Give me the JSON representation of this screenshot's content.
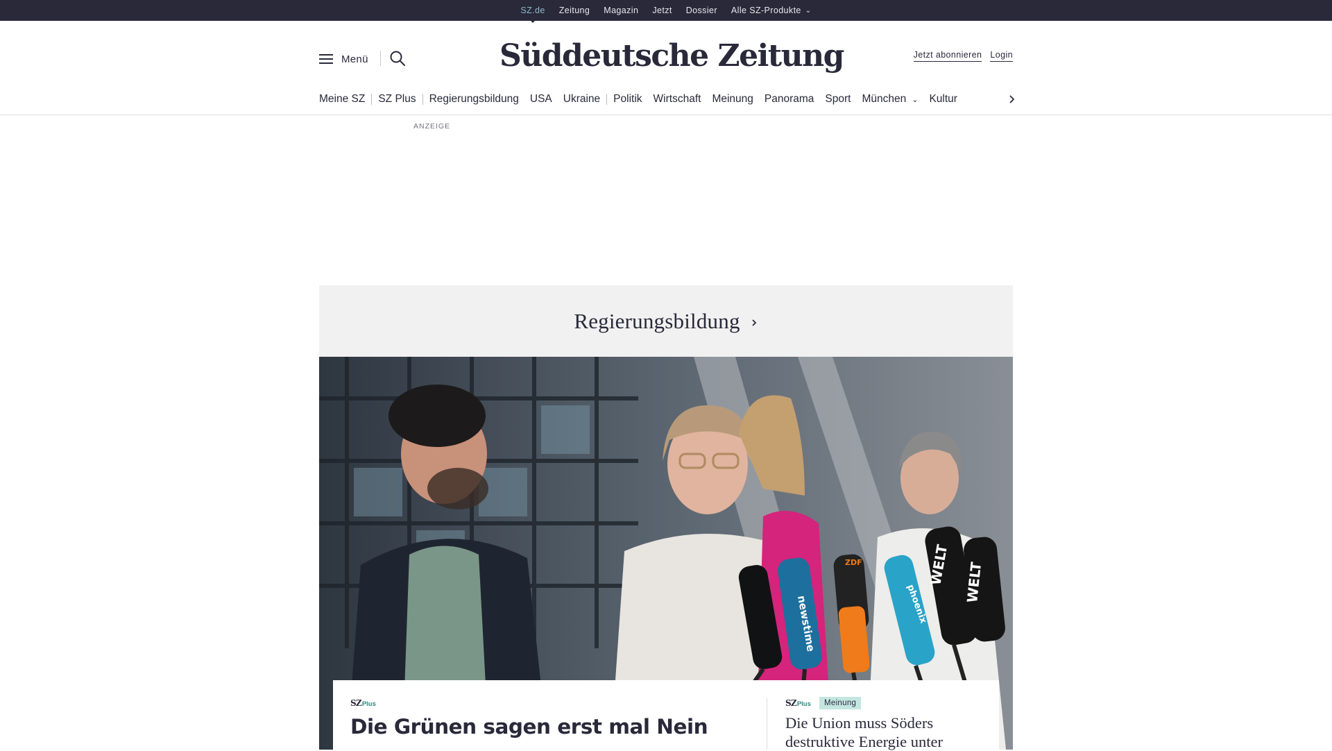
{
  "topbar": {
    "items": [
      {
        "label": "SZ.de",
        "active": true
      },
      {
        "label": "Zeitung"
      },
      {
        "label": "Magazin"
      },
      {
        "label": "Jetzt"
      },
      {
        "label": "Dossier"
      },
      {
        "label": "Alle SZ-Produkte",
        "dropdown": true
      }
    ]
  },
  "header": {
    "menu_label": "Menü",
    "logo": "Süddeutsche Zeitung",
    "subscribe_label": "Jetzt abonnieren",
    "login_label": "Login"
  },
  "nav": {
    "items": [
      "Meine SZ",
      "SZ Plus",
      "Regierungsbildung",
      "USA",
      "Ukraine",
      "Politik",
      "Wirtschaft",
      "Meinung",
      "Panorama",
      "Sport",
      "München",
      "Kultur"
    ],
    "dropdown_item": "München"
  },
  "ad": {
    "label": "ANZEIGE"
  },
  "topic": {
    "title": "Regierungsbildung"
  },
  "hero_image": {
    "mic_brands": [
      "newstime",
      "phoenix",
      "WELT",
      "WELT",
      "ZDF"
    ]
  },
  "teaser_main": {
    "kicker_sz": "SZ",
    "kicker_plus": "Plus",
    "title": "Die Grünen sagen erst mal Nein"
  },
  "teaser_side": {
    "kicker_sz": "SZ",
    "kicker_plus": "Plus",
    "badge": "Meinung",
    "title": "Die Union muss Söders destruktive Energie unter"
  },
  "colors": {
    "topbar_bg": "#29293a",
    "accent_teal": "#2a8a7c",
    "badge_bg": "#c4e6e1",
    "banner_bg": "#f1f1f1"
  }
}
